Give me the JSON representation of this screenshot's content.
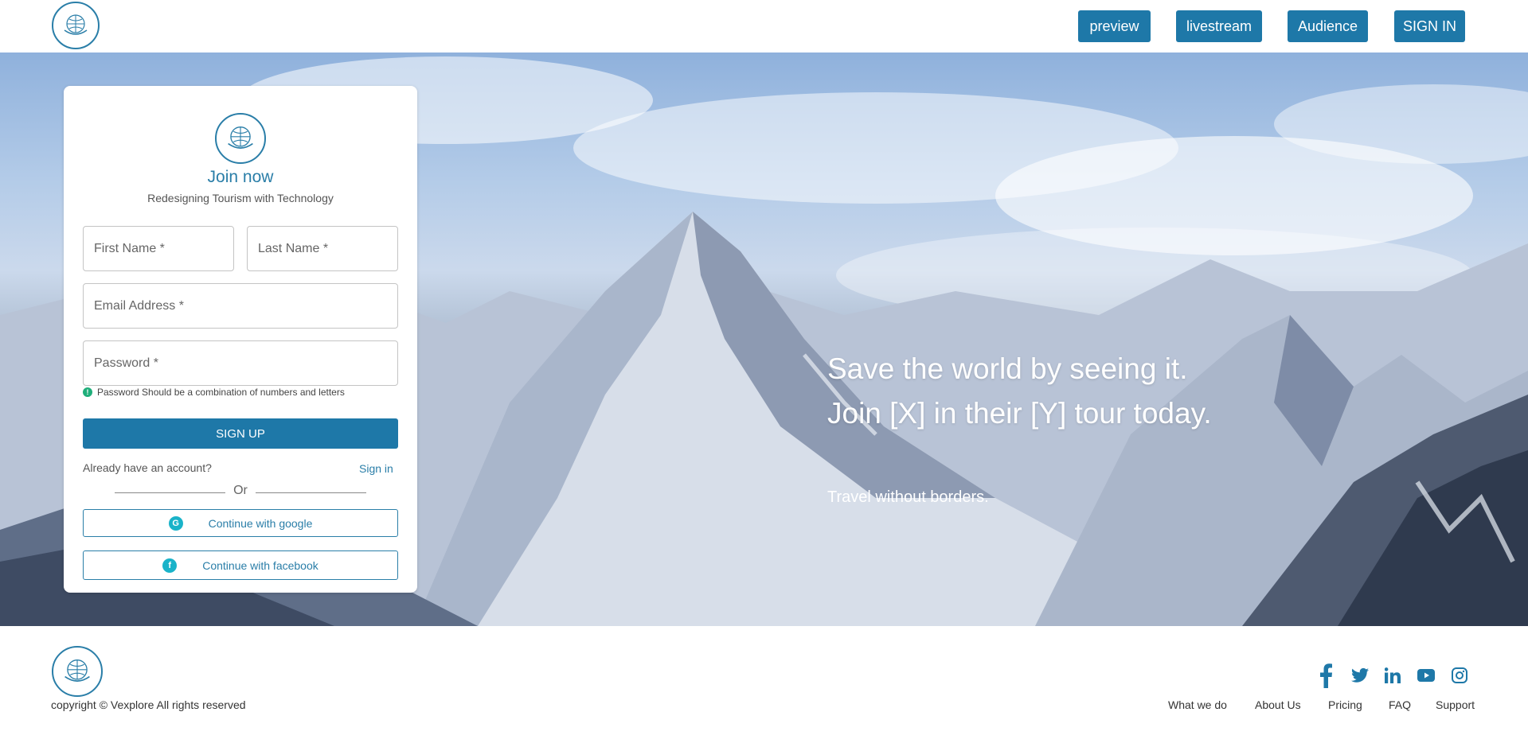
{
  "header": {
    "logo_icon": "globe-logo-icon",
    "nav": [
      "preview",
      "livestream",
      "Audience",
      "SIGN IN"
    ]
  },
  "signup_card": {
    "logo_icon": "globe-logo-icon",
    "title": "Join now",
    "subtitle": "Redesigning Tourism with Technology",
    "first_name_placeholder": "First Name *",
    "last_name_placeholder": "Last Name *",
    "email_placeholder": "Email Address *",
    "password_placeholder": "Password *",
    "password_hint": "Password Should be a combination of numbers and letters",
    "signup_label": "SIGN UP",
    "already_text": "Already have an account?",
    "signin_link": "Sign in",
    "or_text": "Or",
    "google_label": "Continue with google",
    "facebook_label": "Continue with facebook"
  },
  "hero": {
    "headline_line1": "Save the world by seeing it.",
    "headline_line2": "Join [X] in their [Y] tour today.",
    "tagline": "Travel without borders."
  },
  "footer": {
    "copyright": "copyright © Vexplore All rights reserved",
    "social_icons": [
      "facebook-icon",
      "twitter-icon",
      "linkedin-icon",
      "youtube-icon",
      "instagram-icon"
    ],
    "links": [
      "What we do",
      "About Us",
      "Pricing",
      "FAQ",
      "Support"
    ]
  },
  "colors": {
    "primary": "#1e78a8",
    "accent_teal": "#1ab3c9"
  }
}
